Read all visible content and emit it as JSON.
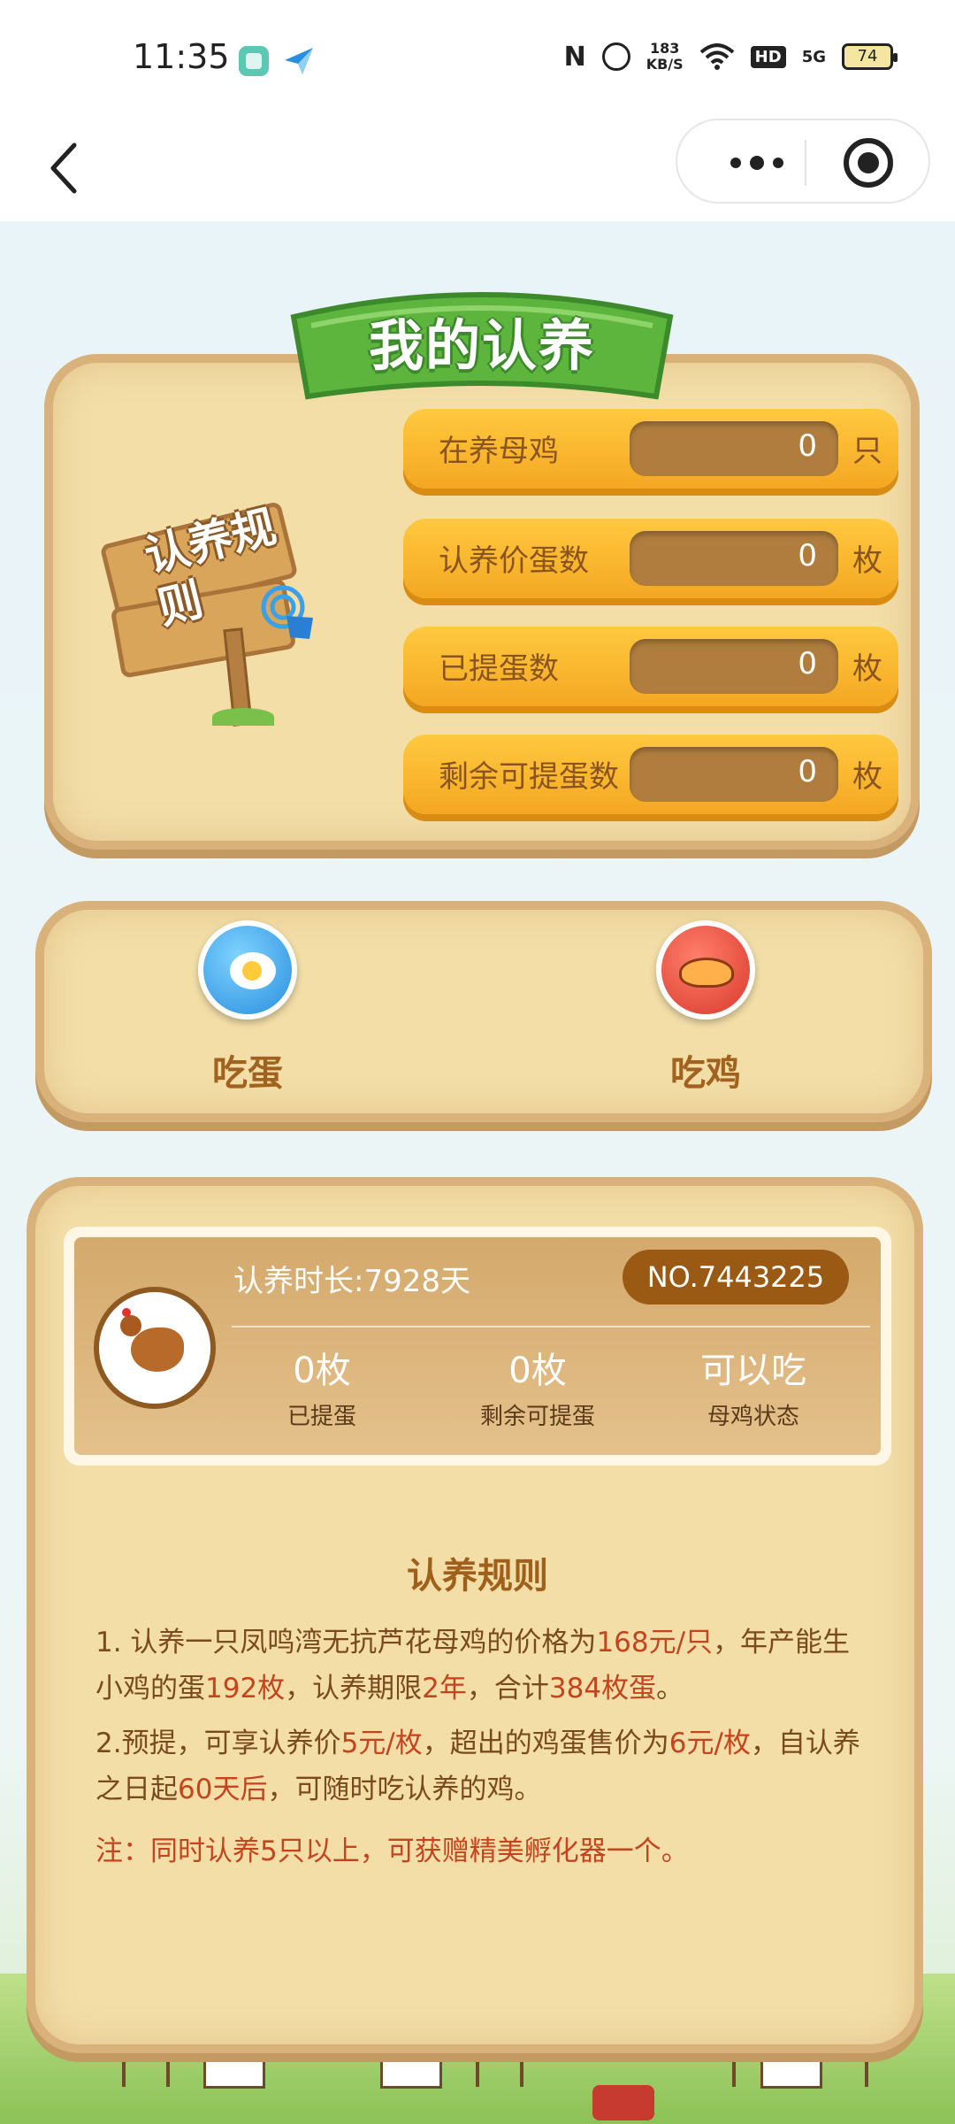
{
  "status_bar": {
    "time": "11:35",
    "speed_value": "183",
    "speed_unit": "KB/S",
    "network": "5G",
    "hd": "HD",
    "battery": "74"
  },
  "nav": {
    "back_icon": "chevron-left-icon",
    "more_icon": "more-dots-icon",
    "close_icon": "target-icon"
  },
  "banner": {
    "title": "我的认养"
  },
  "signpost": {
    "text": "认养规则"
  },
  "stats": [
    {
      "label": "在养母鸡",
      "value": "0",
      "unit": "只"
    },
    {
      "label": "认养价蛋数",
      "value": "0",
      "unit": "枚"
    },
    {
      "label": "已提蛋数",
      "value": "0",
      "unit": "枚"
    },
    {
      "label": "剩余可提蛋数",
      "value": "0",
      "unit": "枚"
    }
  ],
  "actions": [
    {
      "label": "吃蛋",
      "icon": "fried-egg-icon"
    },
    {
      "label": "吃鸡",
      "icon": "roast-chicken-icon"
    }
  ],
  "card": {
    "duration": "认养时长:7928天",
    "number": "NO.7443225",
    "metrics": [
      {
        "value": "0枚",
        "label": "已提蛋"
      },
      {
        "value": "0枚",
        "label": "剩余可提蛋"
      },
      {
        "value": "可以吃",
        "label": "母鸡状态"
      }
    ]
  },
  "rules": {
    "title": "认养规则",
    "p1": {
      "t1": "1.  认养一只凤鸣湾无抗芦花母鸡的价格为",
      "h1": "168元/只",
      "t2": "，年产能生小鸡的蛋",
      "h2": "192枚",
      "t3": "，认养期限",
      "h3": "2年",
      "t4": "，合计",
      "h4": "384枚蛋",
      "t5": "。"
    },
    "p2": {
      "t1": "2.预提，可享认养价",
      "h1": "5元/枚",
      "t2": "，超出的鸡蛋售价为",
      "h2": "6元/枚",
      "t3": "，自认养之日起",
      "h3": "60天后",
      "t4": "，可随时吃认养的鸡。"
    },
    "note": "注：同时认养5只以上，可获赠精美孵化器一个。"
  },
  "colors": {
    "wood": "#f3dea8",
    "wood_border": "#d8b27a",
    "stat_orange": "#f4a722",
    "ribbon_green": "#5db53e",
    "highlight": "#c4441e"
  }
}
